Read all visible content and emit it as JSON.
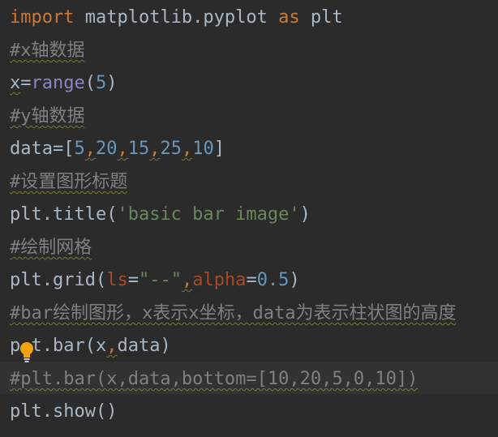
{
  "colors": {
    "background": "#2b2b2b",
    "keyword": "#cc7832",
    "comment": "#808080",
    "builtin": "#8888c6",
    "number": "#6897bb",
    "string": "#6a8759",
    "kwarg": "#aa4926",
    "identifier": "#a9b7c6",
    "bulb": "#f0a30a"
  },
  "code": {
    "l1": {
      "kw_import": "import",
      "module": " matplotlib.pyplot ",
      "kw_as": "as",
      "alias": " plt"
    },
    "l2": {
      "comment": "#x轴数据"
    },
    "l3": {
      "var": "x",
      "eq": "=",
      "fn": "range",
      "open": "(",
      "n": "5",
      "close": ")"
    },
    "l4": {
      "comment": "#y轴数据"
    },
    "l5": {
      "var": "data",
      "eq": "=",
      "open": "[",
      "n1": "5",
      "c1": ",",
      "n2": "20",
      "c2": ",",
      "n3": "15",
      "c3": ",",
      "n4": "25",
      "c4": ",",
      "n5": "10",
      "close": "]"
    },
    "l6": {
      "comment": "#设置图形标题"
    },
    "l7": {
      "call": "plt.title(",
      "str": "'basic bar image'",
      "close": ")"
    },
    "l8": {
      "comment": "#绘制网格"
    },
    "l9": {
      "call": "plt.grid(",
      "ls": "ls",
      "eq1": "=",
      "str": "\"--\"",
      "comma": ",",
      "alpha": "alpha",
      "eq2": "=",
      "num": "0.5",
      "close": ")"
    },
    "l10": {
      "comment": "#bar绘制图形，x表示x坐标，data为表示柱状图的高度"
    },
    "l11": {
      "p": "p",
      "gap": " ",
      "rest1": "t.bar(x",
      "comma": ",",
      "rest2": "data)"
    },
    "l12": {
      "comment": "#plt.bar(x,data,bottom=[10,20,5,0,10])"
    },
    "l13": {
      "code": "plt.show()"
    }
  },
  "intention_icon": "lightbulb-icon"
}
